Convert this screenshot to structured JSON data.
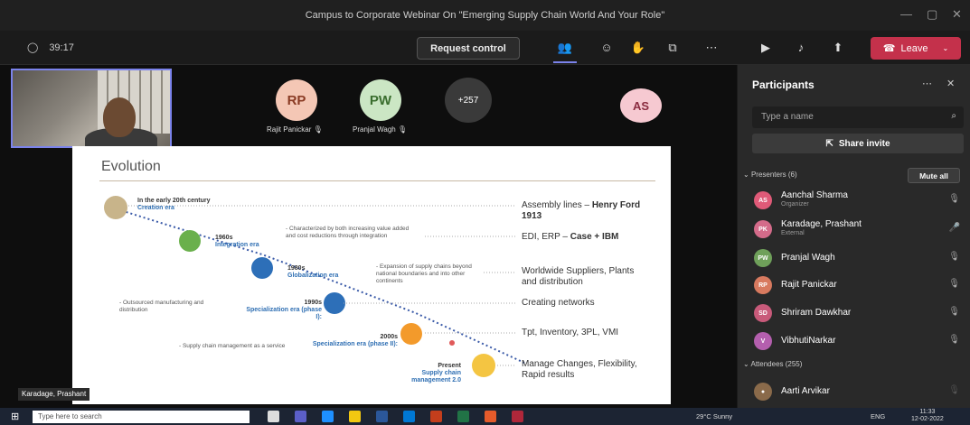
{
  "window": {
    "title": "Campus to Corporate Webinar On \"Emerging Supply Chain World And Your Role\""
  },
  "toolbar": {
    "timer": "39:17",
    "request_control": "Request control",
    "leave": "Leave"
  },
  "stage": {
    "tiles": [
      {
        "initials": "RP",
        "name": "Rajit Panickar",
        "color": "#f4c7b5",
        "text_color": "#8a3b24"
      },
      {
        "initials": "PW",
        "name": "Pranjal Wagh",
        "color": "#cbe6c4",
        "text_color": "#3b6e2f"
      },
      {
        "initials": "+257",
        "name": "",
        "color": "#3a3a3a",
        "text_color": "#ffffff"
      },
      {
        "initials": "AS",
        "name": "",
        "color": "#f6c9d1",
        "text_color": "#8a2c40"
      }
    ],
    "camera_label": "Karadage, Prashant"
  },
  "slide": {
    "title": "Evolution",
    "eras": [
      {
        "year": "In the early 20th century",
        "name": "Creation era"
      },
      {
        "year": "1960s",
        "name": "Integration era"
      },
      {
        "year": "1980s",
        "name": "Globalization era"
      },
      {
        "year": "1990s",
        "name": "Specialization era (phase I):"
      },
      {
        "year": "2000s",
        "name": "Specialization era (phase II):"
      },
      {
        "year": "Present",
        "name": "Supply chain management 2.0"
      }
    ],
    "descriptions": [
      "- Characterized by both increasing value added and cost reductions through integration",
      "- Expansion of supply chains beyond national boundaries and into other continents",
      "- Outsourced manufacturing and distribution",
      "- Supply chain management as a service"
    ],
    "right_labels": [
      {
        "text": "Assembly lines – ",
        "bold": "Henry Ford 1913"
      },
      {
        "text": "EDI, ERP – ",
        "bold": "Case + IBM"
      },
      {
        "text": "Worldwide Suppliers, Plants and distribution",
        "bold": ""
      },
      {
        "text": "Creating networks",
        "bold": ""
      },
      {
        "text": "Tpt, Inventory, 3PL, VMI",
        "bold": ""
      },
      {
        "text": "Manage Changes, Flexibility, Rapid results",
        "bold": ""
      }
    ]
  },
  "panel": {
    "title": "Participants",
    "search_placeholder": "Type a name",
    "share_invite": "Share invite",
    "presenters_label": "Presenters (6)",
    "mute_all": "Mute all",
    "attendees_label": "Attendees (255)",
    "presenters": [
      {
        "initials": "AS",
        "name": "Aanchal Sharma",
        "role": "Organizer",
        "color": "#e05a78"
      },
      {
        "initials": "PK",
        "name": "Karadage, Prashant",
        "role": "External",
        "color": "#d46b8a"
      },
      {
        "initials": "PW",
        "name": "Pranjal Wagh",
        "role": "",
        "color": "#6fa05a"
      },
      {
        "initials": "RP",
        "name": "Rajit Panickar",
        "role": "",
        "color": "#d87a5f"
      },
      {
        "initials": "SD",
        "name": "Shriram Dawkhar",
        "role": "",
        "color": "#c85a7a"
      },
      {
        "initials": "V",
        "name": "VibhutiNarkar",
        "role": "",
        "color": "#b45fae"
      }
    ],
    "attendees": [
      {
        "name": "Aarti Arvikar"
      }
    ]
  },
  "taskbar": {
    "search": "Type here to search",
    "weather": "29°C Sunny",
    "lang": "ENG",
    "time": "11:33",
    "date": "12-02-2022"
  }
}
